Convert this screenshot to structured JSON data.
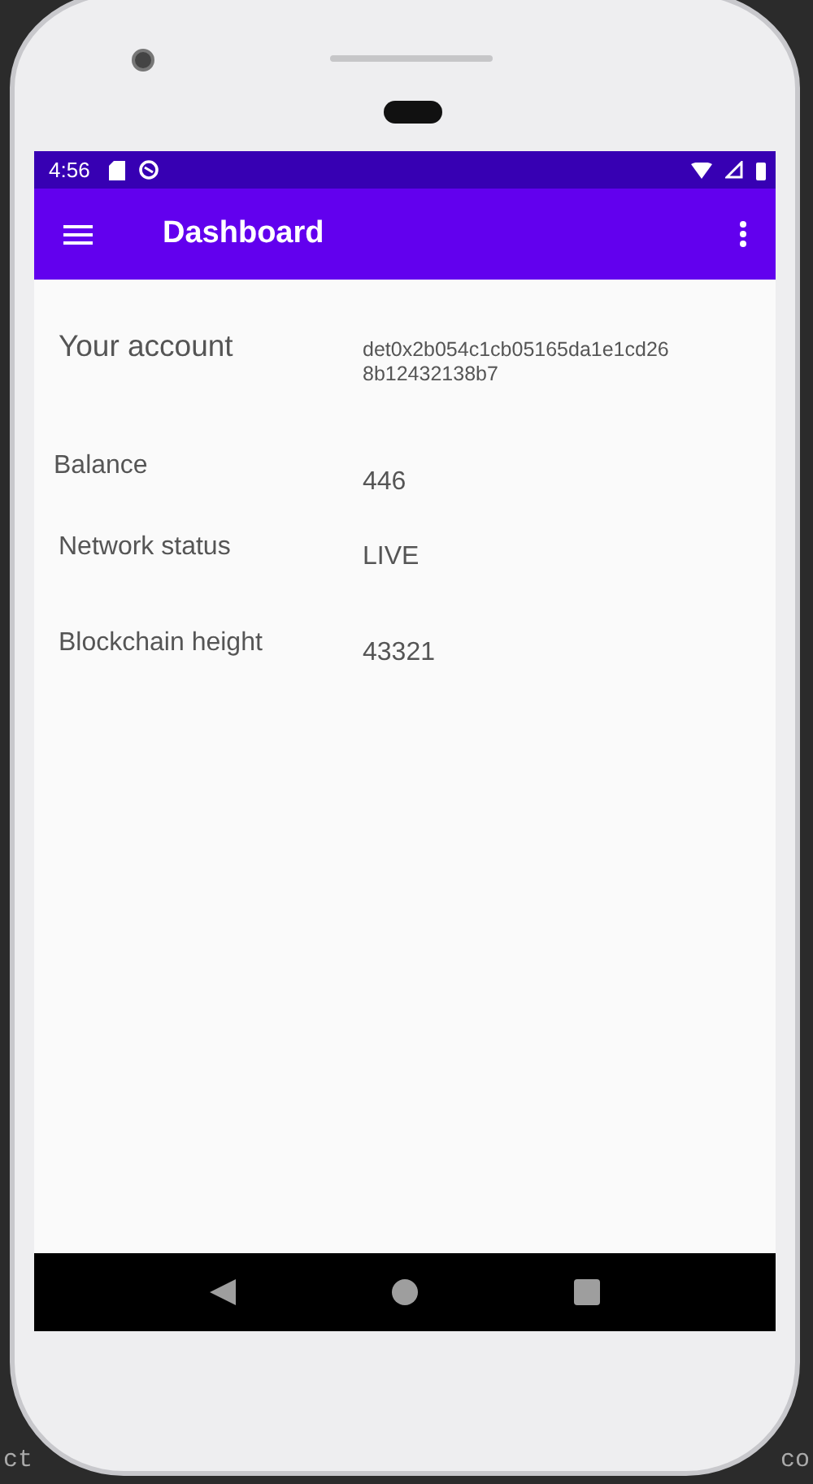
{
  "status_bar": {
    "time": "4:56"
  },
  "app_bar": {
    "title": "Dashboard"
  },
  "rows": [
    {
      "label": "Your account",
      "value": "det0x2b054c1cb05165da1e1cd26\n8b12432138b7",
      "kind": "mono"
    },
    {
      "label": "Balance",
      "value": "446",
      "kind": "plain"
    },
    {
      "label": "Network status",
      "value": "LIVE",
      "kind": "plain"
    },
    {
      "label": "Blockchain height",
      "value": "43321",
      "kind": "plain"
    }
  ],
  "background_text": [
    "ct",
    "co"
  ]
}
